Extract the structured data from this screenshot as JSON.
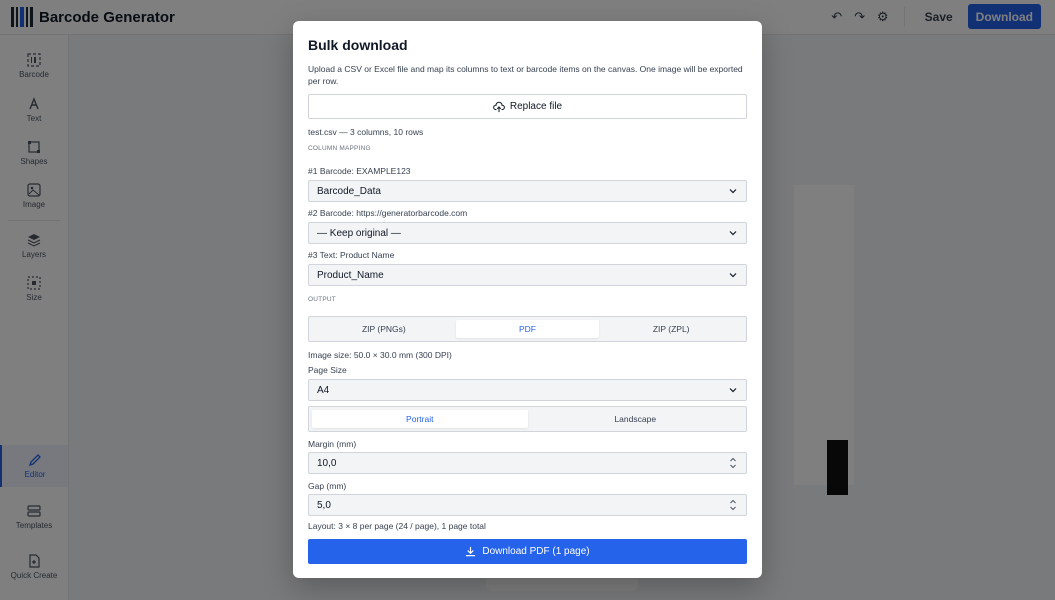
{
  "app": {
    "title": "Barcode Generator",
    "save_label": "Save",
    "download_label": "Download"
  },
  "sidebar": {
    "items": [
      {
        "label": "Barcode",
        "icon": "barcode-icon"
      },
      {
        "label": "Text",
        "icon": "text-icon"
      },
      {
        "label": "Shapes",
        "icon": "shapes-icon"
      },
      {
        "label": "Image",
        "icon": "image-icon"
      },
      {
        "label": "Layers",
        "icon": "layers-icon"
      },
      {
        "label": "Size",
        "icon": "size-icon"
      },
      {
        "label": "Editor",
        "icon": "pencil-icon"
      },
      {
        "label": "Templates",
        "icon": "templates-icon"
      },
      {
        "label": "Quick Create",
        "icon": "quick-create-icon"
      }
    ]
  },
  "modal": {
    "title": "Bulk download",
    "description": "Upload a CSV or Excel file and map its columns to text or barcode items on the canvas. One image will be exported per row.",
    "replace_label": "Replace file",
    "file_info": "test.csv — 3 columns, 10 rows",
    "column_mapping_label": "COLUMN MAPPING",
    "mappings": [
      {
        "label": "#1 Barcode: EXAMPLE123",
        "value": "Barcode_Data"
      },
      {
        "label": "#2 Barcode: https://generatorbarcode.com",
        "value": "— Keep original —"
      },
      {
        "label": "#3 Text: Product Name",
        "value": "Product_Name"
      }
    ],
    "output_label": "OUTPUT",
    "formats": [
      "ZIP (PNGs)",
      "PDF",
      "ZIP (ZPL)"
    ],
    "selected_format": "PDF",
    "image_size": "Image size: 50.0 × 30.0 mm (300 DPI)",
    "page_size_label": "Page Size",
    "page_size_value": "A4",
    "orientations": [
      "Portrait",
      "Landscape"
    ],
    "selected_orientation": "Portrait",
    "margin_label": "Margin (mm)",
    "margin_value": "10,0",
    "gap_label": "Gap (mm)",
    "gap_value": "5,0",
    "layout_info": "Layout: 3 × 8 per page (24 / page), 1 page total",
    "download_pdf_label": "Download PDF (1 page)"
  },
  "colors": {
    "accent": "#2563eb",
    "overlay": "rgba(0,0,0,0.5)"
  }
}
